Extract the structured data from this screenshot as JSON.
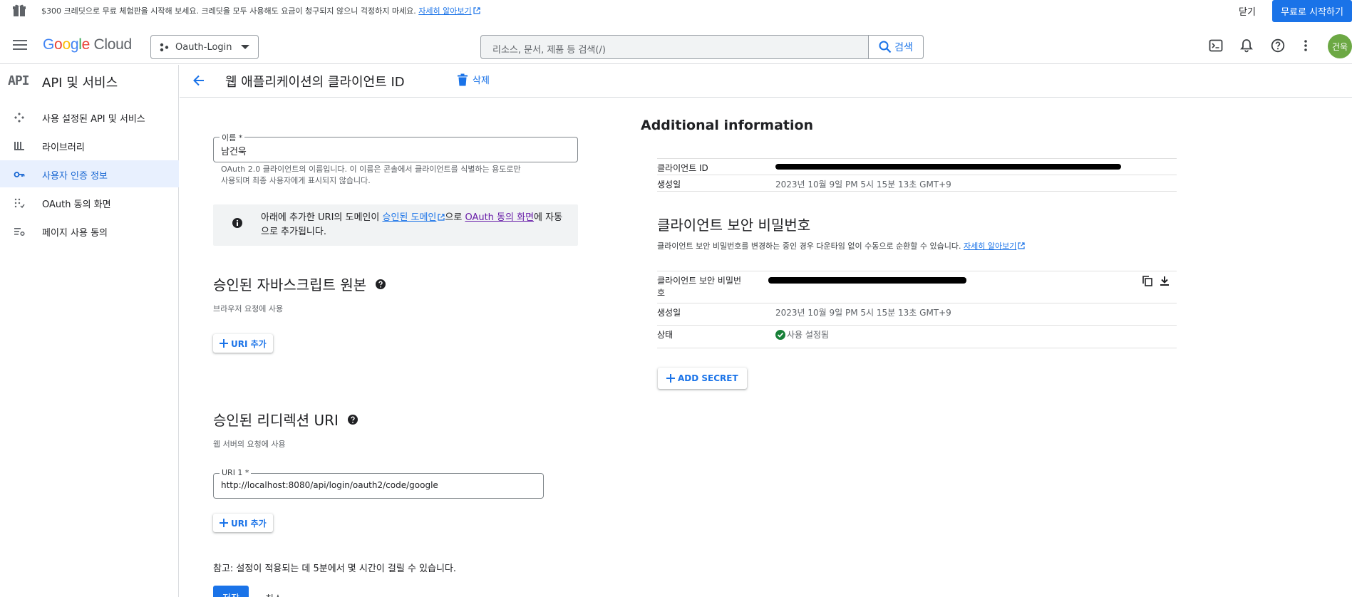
{
  "promo": {
    "text": "$300 크레딧으로 무료 체험판을 시작해 보세요. 크레딧을 모두 사용해도 요금이 청구되지 않으니 걱정하지 마세요.",
    "link": "자세히 알아보기",
    "close": "닫기",
    "start": "무료로 시작하기"
  },
  "header": {
    "logo_google": "Google",
    "logo_cloud": "Cloud",
    "project": "Oauth-Login",
    "search_placeholder": "리소스, 문서, 제품 등 검색(/)",
    "search_button": "검색",
    "avatar": "건욱"
  },
  "sidebar": {
    "api_logo": "API",
    "title": "API 및 서비스",
    "items": [
      {
        "label": "사용 설정된 API 및 서비스",
        "icon": "diamond-grid-icon",
        "active": false
      },
      {
        "label": "라이브러리",
        "icon": "library-icon",
        "active": false
      },
      {
        "label": "사용자 인증 정보",
        "icon": "key-icon",
        "active": true
      },
      {
        "label": "OAuth 동의 화면",
        "icon": "oauth-consent-icon",
        "active": false
      },
      {
        "label": "페이지 사용 동의",
        "icon": "page-settings-icon",
        "active": false
      }
    ]
  },
  "page": {
    "title": "웹 애플리케이션의 클라이언트 ID",
    "delete": "삭제"
  },
  "form": {
    "name_label": "이름 *",
    "name_value": "남건욱",
    "name_hint_1": "OAuth 2.0 클라이언트의 이름입니다. 이 이름은 콘솔에서 클라이언트를 식별하는 용도로만",
    "name_hint_2": "사용되며 최종 사용자에게 표시되지 않습니다.",
    "info_1": "아래에 추가한 URI의 도메인이 ",
    "info_link1": "승인된 도메인",
    "info_2": "으로 ",
    "info_link2": "OAuth 동의 화면",
    "info_3": "에 자동으로 추가됩니다.",
    "js_title": "승인된 자바스크립트 원본",
    "js_desc": "브라우저 요청에 사용",
    "add_uri": "URI 추가",
    "redirect_title": "승인된 리디렉션 URI",
    "redirect_desc": "웹 서버의 요청에 사용",
    "uri1_label": "URI 1 *",
    "uri1_value": "http://localhost:8080/api/login/oauth2/code/google",
    "note": "참고: 설정이 적용되는 데 5분에서 몇 시간이 걸릴 수 있습니다.",
    "save": "저장",
    "cancel": "취소"
  },
  "info": {
    "title": "Additional information",
    "client_id_label": "클라이언트 ID",
    "created_label": "생성일",
    "created_value": "2023년 10월 9일 PM 5시 15분 13초 GMT+9",
    "secret_title": "클라이언트 보안 비밀번호",
    "secret_desc": "클라이언트 보안 비밀번호를 변경하는 중인 경우 다운타임 없이 수동으로 순환할 수 있습니다.",
    "secret_link": "자세히 알아보기",
    "secret_label_1": "클라이언트 보안 비밀번",
    "secret_label_2": "호",
    "secret_created_label": "생성일",
    "secret_created_value": "2023년 10월 9일 PM 5시 15분 13초 GMT+9",
    "status_label": "상태",
    "status_value": "사용 설정됨",
    "add_secret": "ADD SECRET"
  },
  "colors": {
    "accent": "#1a73e8",
    "active_bg": "#e8f0fe",
    "status_ok": "#188038",
    "avatar": "#6ca844"
  }
}
